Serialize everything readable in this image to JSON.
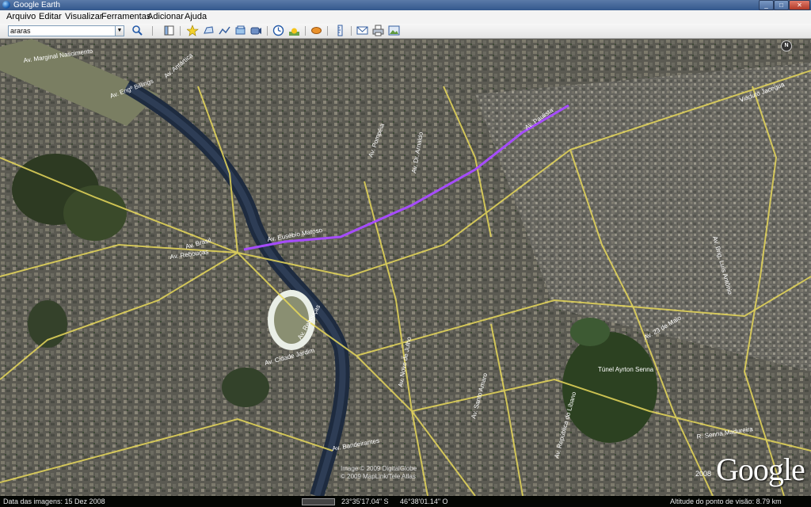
{
  "window": {
    "title": "Google Earth",
    "min": "_",
    "max": "□",
    "close": "✕"
  },
  "menu": [
    "Arquivo",
    "Editar",
    "Visualizar",
    "Ferramentas",
    "Adicionar",
    "Ajuda"
  ],
  "search": {
    "value": "araras"
  },
  "toolbar": {
    "icons": [
      "search-icon",
      "sidebar-icon",
      "placemark-icon",
      "polygon-icon",
      "path-icon",
      "overlay-icon",
      "record-tour-icon",
      "historical-imagery-icon",
      "sun-icon",
      "planets-icon",
      "ruler-icon",
      "email-icon",
      "print-icon",
      "save-image-icon"
    ]
  },
  "map": {
    "north_label": "N",
    "road_labels": [
      "Av. Marginal Nascimento",
      "Av. Engº Billings",
      "Av. Antártica",
      "Av. Pompéia",
      "Av. Brasil",
      "Av. Rebouças",
      "Av. Eusébio Matoso",
      "Av. Paulista",
      "Av. Brig. Luís Antônio",
      "Av. 23 de Maio",
      "Túnel Ayrton Senna",
      "Av. República do Líbano",
      "Av. Santo Amaro",
      "Av. Bandeirantes",
      "Av. Cidade Jardim",
      "R. Senna Madureira",
      "Viaduto Jacegua",
      "Av. Nove de Julho",
      "Av. Rebouças",
      "Av. Dr. Arnaldo"
    ],
    "highlighted_route": "Av. Eusébio Matoso",
    "copyright_lines": [
      "Image © 2009 DigitalGlobe",
      "© 2009 MapLink/Tele Atlas"
    ],
    "logo_year": "2008",
    "logo_text": "Google"
  },
  "status": {
    "imagery_date": "Data das imagens: 15 Dez 2008",
    "lat": "23°35'17.04\" S",
    "lon": "46°38'01.14\" O",
    "eye_alt": "Altitude do ponto de visão: 8.79 km"
  },
  "colors": {
    "route": "#a64cff",
    "road": "#e7d85a",
    "river": "#23324a"
  }
}
